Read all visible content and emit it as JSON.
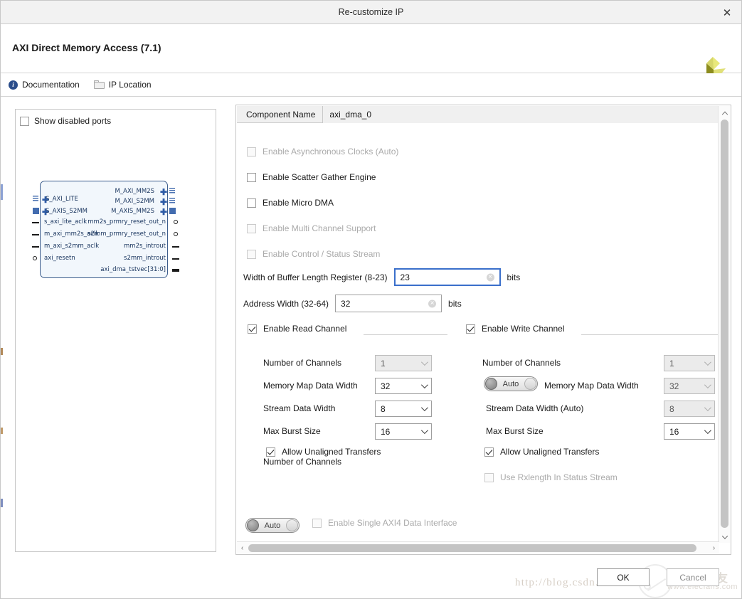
{
  "window": {
    "title": "Re-customize IP",
    "close_icon": "close-icon"
  },
  "header": {
    "ip_title": "AXI Direct Memory Access (7.1)",
    "logo_icon": "xilinx-logo-icon"
  },
  "toolbar": {
    "documentation_label": "Documentation",
    "documentation_icon": "info-icon",
    "ip_location_label": "IP Location",
    "ip_location_icon": "folder-icon"
  },
  "ports_panel": {
    "show_disabled_label": "Show disabled ports",
    "show_disabled_checked": false,
    "diagram": {
      "left_bus_ports": [
        "S_AXI_LITE",
        "S_AXIS_S2MM"
      ],
      "left_pin_ports": [
        "s_axi_lite_aclk",
        "m_axi_mm2s_aclk",
        "m_axi_s2mm_aclk",
        "axi_resetn"
      ],
      "right_bus_ports": [
        "M_AXI_MM2S",
        "M_AXI_S2MM",
        "M_AXIS_MM2S"
      ],
      "right_pin_ports": [
        "mm2s_prmry_reset_out_n",
        "s2mm_prmry_reset_out_n",
        "mm2s_introut",
        "s2mm_introut",
        "axi_dma_tstvec[31:0]"
      ]
    }
  },
  "config": {
    "component_name_label": "Component Name",
    "component_name_value": "axi_dma_0",
    "checkboxes": [
      {
        "label": "Enable Asynchronous Clocks (Auto)",
        "checked": false,
        "disabled": true
      },
      {
        "label": "Enable Scatter Gather Engine",
        "checked": false,
        "disabled": false
      },
      {
        "label": "Enable Micro DMA",
        "checked": false,
        "disabled": false
      },
      {
        "label": "Enable Multi Channel Support",
        "checked": false,
        "disabled": true
      },
      {
        "label": "Enable Control / Status Stream",
        "checked": false,
        "disabled": true
      }
    ],
    "buffer_length": {
      "label": "Width of Buffer Length Register (8-23)",
      "value": "23",
      "unit": "bits",
      "focused": true
    },
    "address_width": {
      "label": "Address Width (32-64)",
      "value": "32",
      "unit": "bits",
      "focused": false
    },
    "read_channel": {
      "title": "Enable Read Channel",
      "checked": true,
      "rows": [
        {
          "label": "Number of Channels",
          "value": "1",
          "disabled": true
        },
        {
          "label": "Memory Map Data Width",
          "value": "32",
          "disabled": false
        },
        {
          "label": "Stream Data Width",
          "value": "8",
          "disabled": false
        },
        {
          "label": "Max Burst Size",
          "value": "16",
          "disabled": false
        }
      ],
      "allow_unaligned_label": "Allow Unaligned Transfers",
      "allow_unaligned_checked": true
    },
    "write_channel": {
      "title": "Enable Write Channel",
      "checked": true,
      "rows": [
        {
          "label": "Number of Channels",
          "value": "1",
          "disabled": true
        },
        {
          "label": "Memory Map Data Width",
          "value": "32",
          "disabled": true,
          "toggle": "Auto"
        },
        {
          "label": "Stream Data Width (Auto)",
          "value": "8",
          "disabled": true
        },
        {
          "label": "Max Burst Size",
          "value": "16",
          "disabled": false
        }
      ],
      "allow_unaligned_label": "Allow Unaligned Transfers",
      "allow_unaligned_checked": true,
      "use_rxlength_label": "Use Rxlength In Status Stream",
      "use_rxlength_checked": false,
      "use_rxlength_disabled": true
    },
    "single_axi4": {
      "toggle_label": "Auto",
      "label": "Enable Single AXI4 Data Interface",
      "checked": false,
      "disabled": true
    }
  },
  "footer": {
    "ok_label": "OK",
    "cancel_label": "Cancel"
  },
  "watermark": {
    "url": "http://blog.csdn.r",
    "cn_text": "电子发烧友",
    "site": "www.elecfans.com"
  }
}
